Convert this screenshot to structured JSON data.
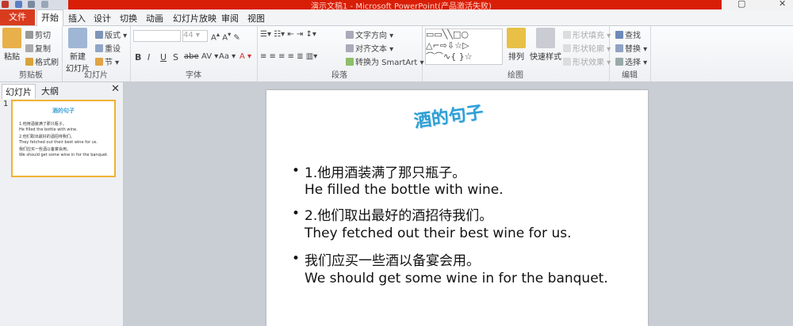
{
  "window": {
    "title": "演示文稿1 - Microsoft PowerPoint(产品激活失败)"
  },
  "tabs": [
    {
      "label": "文件"
    },
    {
      "label": "开始"
    },
    {
      "label": "插入"
    },
    {
      "label": "设计"
    },
    {
      "label": "切换"
    },
    {
      "label": "动画"
    },
    {
      "label": "幻灯片放映"
    },
    {
      "label": "审阅"
    },
    {
      "label": "视图"
    }
  ],
  "ribbon": {
    "clipboard": {
      "label": "剪贴板",
      "paste": "粘贴",
      "cut": "剪切",
      "copy": "复制",
      "painter": "格式刷"
    },
    "slides": {
      "label": "幻灯片",
      "new_slide": "新建",
      "new_slide2": "幻灯片",
      "layout": "版式",
      "reset": "重设",
      "section": "节"
    },
    "font": {
      "label": "字体",
      "size": "44"
    },
    "paragraph": {
      "label": "段落",
      "text_dir": "文字方向",
      "align": "对齐文本",
      "smartart": "转换为 SmartArt"
    },
    "drawing": {
      "label": "绘图",
      "arrange": "排列",
      "quick_styles": "快速样式",
      "fill": "形状填充",
      "outline": "形状轮廓",
      "effects": "形状效果"
    },
    "editing": {
      "label": "编辑",
      "find": "查找",
      "replace": "替换",
      "select": "选择"
    }
  },
  "panel": {
    "tab_slides": "幻灯片",
    "tab_outline": "大纲",
    "close": "✕",
    "slide_num": "1"
  },
  "slide": {
    "title": "酒的句子",
    "bullets": [
      {
        "cn": "1.他用酒装满了那只瓶子。",
        "en": "He filled the bottle with wine."
      },
      {
        "cn": "2.他们取出最好的酒招待我们。",
        "en": "They fetched out their best wine for us."
      },
      {
        "cn": "我们应买一些酒以备宴会用。",
        "en": "We should get some wine in for the banquet."
      }
    ],
    "bullet_char": "•"
  },
  "colors": {
    "file_tab": "#d83b1e",
    "title_blue": "#2d9fd6",
    "titlebar": "#d81e06"
  }
}
